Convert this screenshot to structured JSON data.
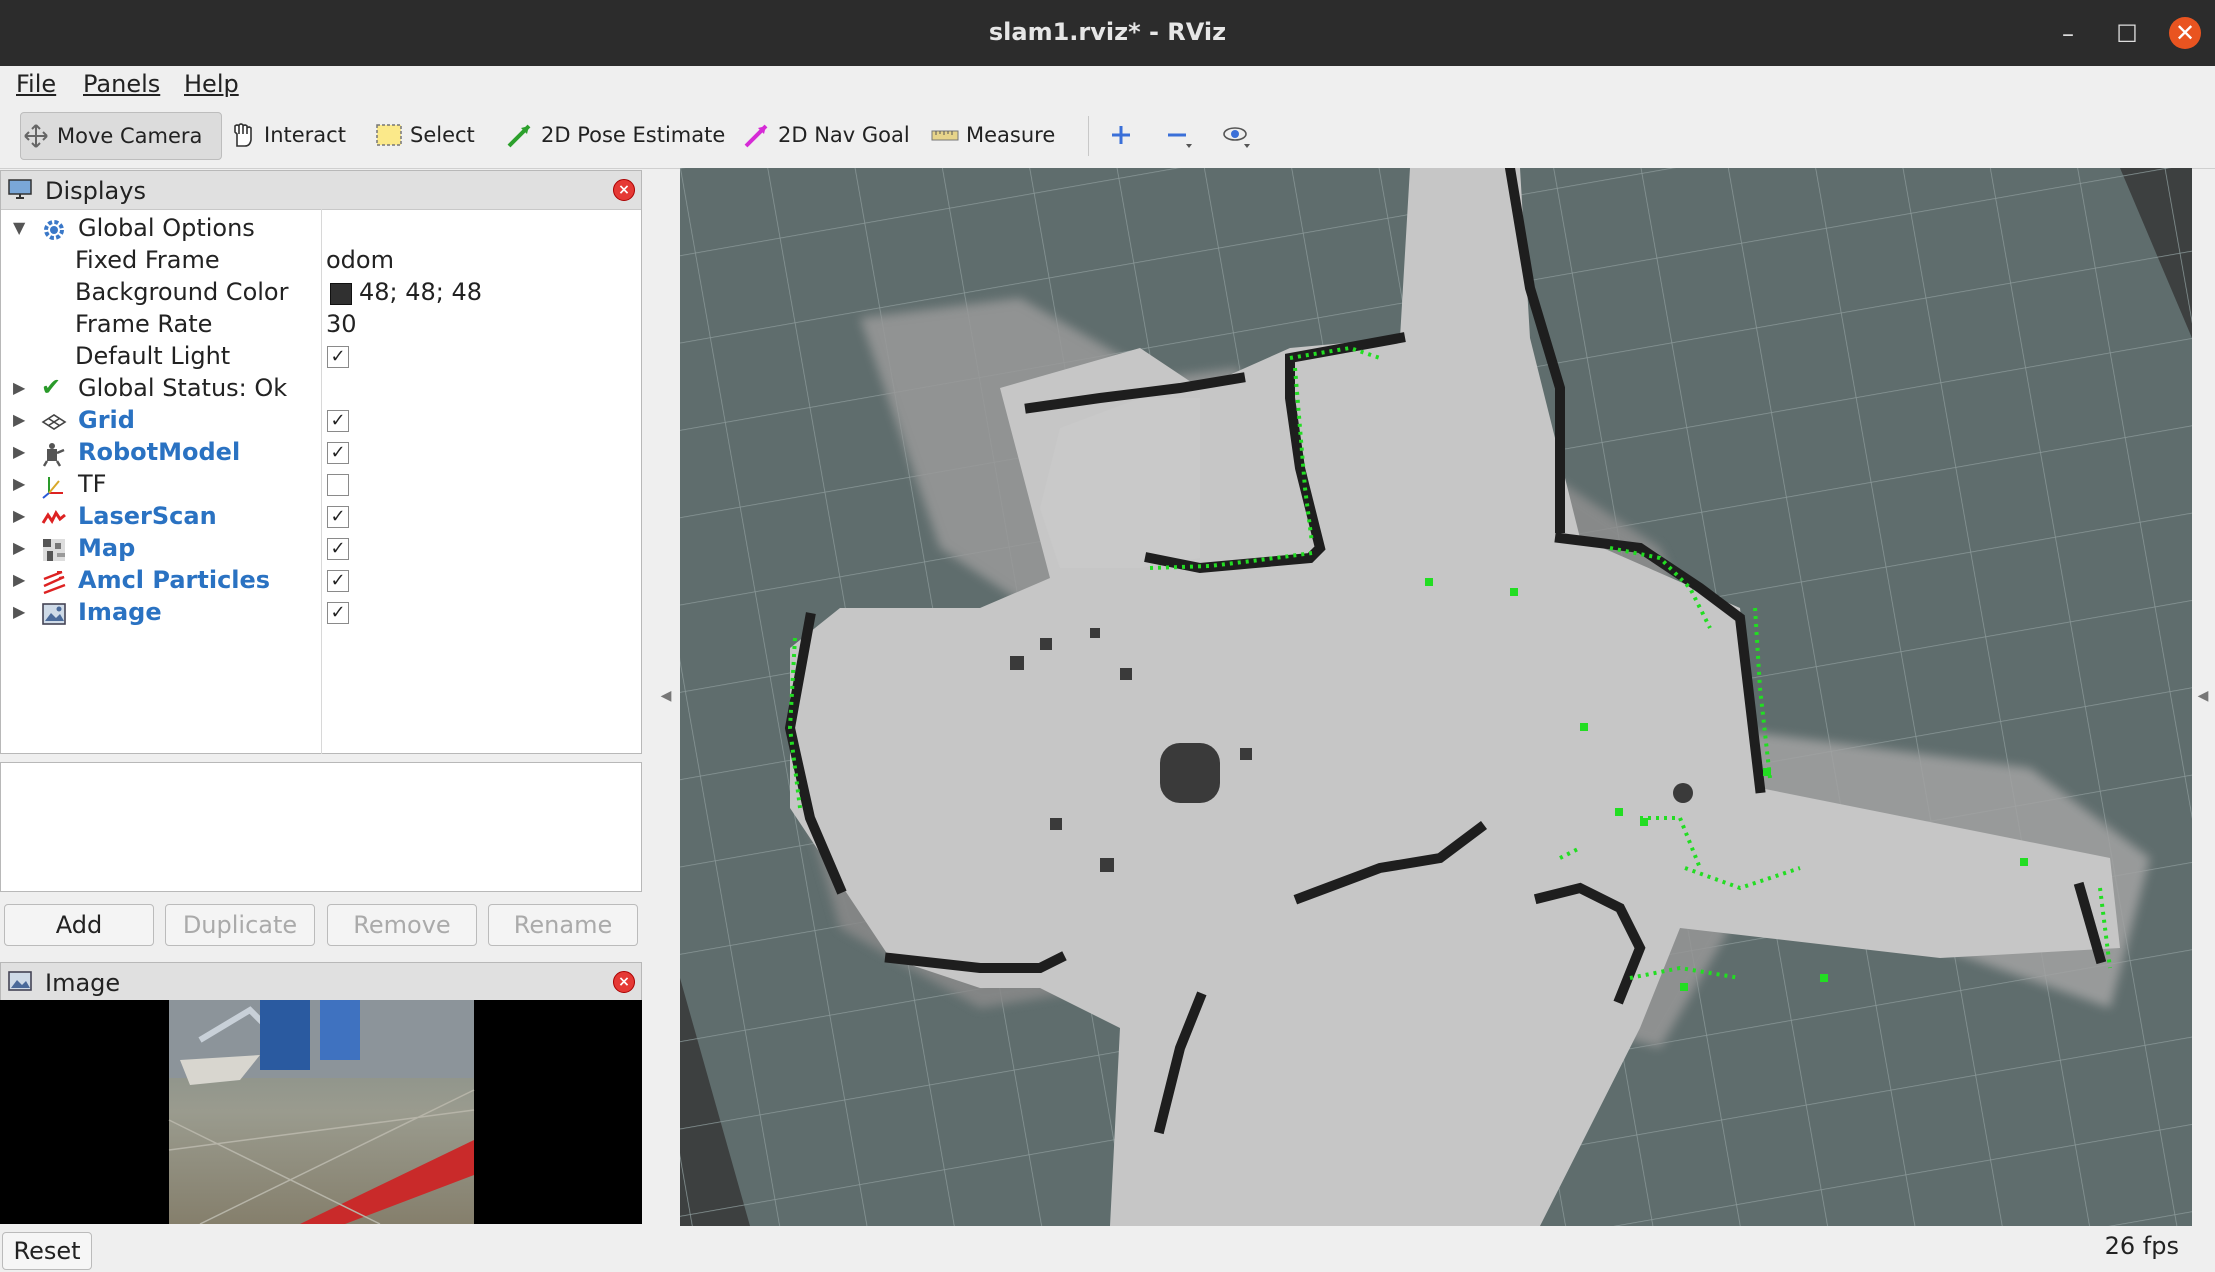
{
  "window": {
    "title": "slam1.rviz* - RViz",
    "minimize_glyph": "–",
    "maximize_glyph": "☐",
    "close_glyph": "✕"
  },
  "menu": {
    "file": "File",
    "panels": "Panels",
    "help": "Help"
  },
  "toolbar": {
    "move_camera": "Move Camera",
    "interact": "Interact",
    "select": "Select",
    "pose_estimate": "2D Pose Estimate",
    "nav_goal": "2D Nav Goal",
    "measure": "Measure"
  },
  "displays_panel": {
    "title": "Displays",
    "global_options": "Global Options",
    "fixed_frame_label": "Fixed Frame",
    "fixed_frame_value": "odom",
    "bg_color_label": "Background Color",
    "bg_color_value": "48; 48; 48",
    "bg_color_hex": "#303030",
    "frame_rate_label": "Frame Rate",
    "frame_rate_value": "30",
    "default_light_label": "Default Light",
    "global_status": "Global Status: Ok",
    "items": [
      {
        "label": "Grid",
        "checked": true
      },
      {
        "label": "RobotModel",
        "checked": true
      },
      {
        "label": "TF",
        "checked": false
      },
      {
        "label": "LaserScan",
        "checked": true
      },
      {
        "label": "Map",
        "checked": true
      },
      {
        "label": "Amcl Particles",
        "checked": true
      },
      {
        "label": "Image",
        "checked": true
      }
    ],
    "buttons": {
      "add": "Add",
      "duplicate": "Duplicate",
      "remove": "Remove",
      "rename": "Rename"
    }
  },
  "image_panel": {
    "title": "Image"
  },
  "status": {
    "reset": "Reset",
    "fps": "26 fps"
  },
  "colors": {
    "accent_blue": "#2a72c2",
    "titlebar": "#2c2c2c",
    "close": "#e95420",
    "laser": "#22dd22",
    "viewport_bg": "#5e6c6c"
  }
}
